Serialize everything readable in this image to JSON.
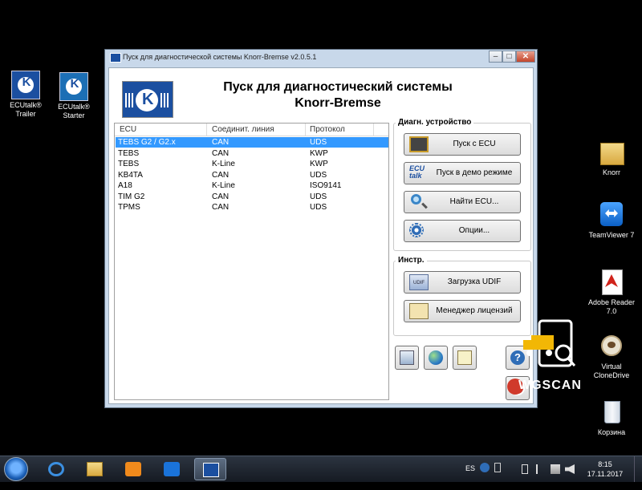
{
  "desktop": {
    "icons_left": [
      {
        "label": "ECUtalk® Trailer",
        "icon": "ecutalk-trailer-icon"
      },
      {
        "label": "ECUtalk® Starter",
        "icon": "ecutalk-starter-icon"
      }
    ],
    "icons_right": [
      {
        "label": "Knorr",
        "icon": "folder-icon"
      },
      {
        "label": "TeamViewer 7",
        "icon": "teamviewer-icon"
      },
      {
        "label": "Adobe Reader 7.0",
        "icon": "adobe-reader-icon"
      },
      {
        "label": "Virtual CloneDrive",
        "icon": "virtual-clonedrive-icon"
      },
      {
        "label": "Корзина",
        "icon": "recycle-bin-icon"
      }
    ]
  },
  "window": {
    "title": "Пуск для диагностической системы Knorr-Bremse  v2.0.5.1",
    "heading_line1": "Пуск для диагностический системы",
    "heading_line2": "Knorr-Bremse",
    "controls": {
      "minimize": "–",
      "maximize": "□",
      "close": "✕"
    }
  },
  "ecu_table": {
    "columns": [
      "ECU",
      "Соединит. линия",
      "Протокол"
    ],
    "rows": [
      [
        "TEBS G2 / G2.x",
        "CAN",
        "UDS"
      ],
      [
        "TEBS",
        "CAN",
        "KWP"
      ],
      [
        "TEBS",
        "K-Line",
        "KWP"
      ],
      [
        "KB4TA",
        "CAN",
        "UDS"
      ],
      [
        "A18",
        "K-Line",
        "ISO9141"
      ],
      [
        "TIM G2",
        "CAN",
        "UDS"
      ],
      [
        "TPMS",
        "CAN",
        "UDS"
      ]
    ],
    "selected_row": 0
  },
  "diag_group": {
    "title": "Диагн. устройство",
    "buttons": [
      {
        "label": "Пуск с ECU",
        "icon": "chip-icon"
      },
      {
        "label": "Пуск в демо режиме",
        "icon": "ecutalk-icon"
      },
      {
        "label": "Найти ECU...",
        "icon": "magnifier-icon"
      },
      {
        "label": "Опции...",
        "icon": "gears-icon"
      }
    ],
    "ecutalk_logo_text": "ECU talk"
  },
  "tools_group": {
    "title": "Инстр.",
    "buttons": [
      {
        "label": "Загрузка UDIF",
        "icon": "udif-icon"
      },
      {
        "label": "Менеджер лицензий",
        "icon": "clipboard-icon"
      }
    ],
    "udif_badge": "UDIF"
  },
  "small_buttons": [
    "network-devices-icon",
    "globe-icon",
    "notepad-icon",
    "help-icon",
    "exit-icon"
  ],
  "help_glyph": "?",
  "watermark": {
    "text": "WGSCAN"
  },
  "taskbar": {
    "language": "ES",
    "time": "8:15",
    "date": "17.11.2017",
    "apps": [
      "internet-explorer-icon",
      "explorer-folder-icon",
      "media-player-icon",
      "teamviewer-icon",
      "knorr-bremse-icon"
    ]
  },
  "colors": {
    "selection": "#3399ff",
    "knorr_blue": "#1b4fa0",
    "desktop": "#000000"
  }
}
